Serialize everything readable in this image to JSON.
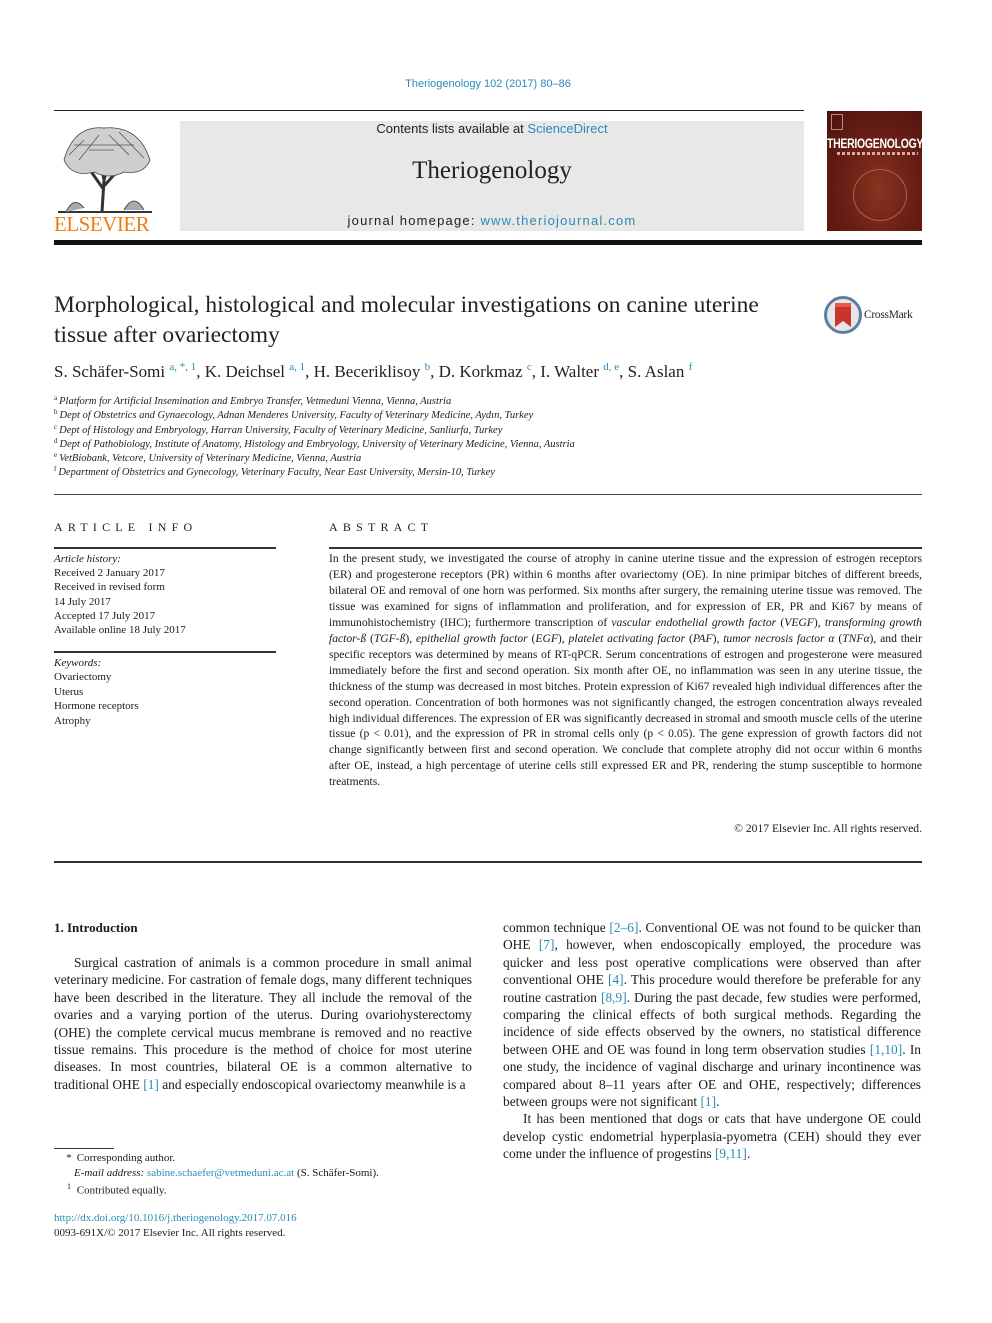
{
  "header": {
    "journal_ref": "Theriogenology 102 (2017) 80–86",
    "contents_prefix": "Contents lists available at ",
    "contents_link": "ScienceDirect",
    "journal_title": "Theriogenology",
    "homepage_prefix": "journal homepage: ",
    "homepage_link": "www.theriojournal.com",
    "publisher_logo_text": "ELSEVIER",
    "cover_title": "THERIOGENOLOGY",
    "brand_colors": {
      "link": "#2a8bb5",
      "elsevier_orange": "#f07d14",
      "cover": "#6b2016"
    }
  },
  "article": {
    "title": "Morphological, histological and molecular investigations on canine uterine tissue after ovariectomy",
    "crossmark_label": "CrossMark",
    "authors": [
      {
        "name": "S. Schäfer-Somi",
        "sup": "a, *, 1",
        "sep": ", "
      },
      {
        "name": "K. Deichsel",
        "sup": "a, 1",
        "sep": ", "
      },
      {
        "name": "H. Beceriklisoy",
        "sup": "b",
        "sep": ", "
      },
      {
        "name": "D. Korkmaz",
        "sup": "c",
        "sep": ", "
      },
      {
        "name": "I. Walter",
        "sup": "d, e",
        "sep": ", "
      },
      {
        "name": "S. Aslan",
        "sup": "f",
        "sep": ""
      }
    ],
    "affiliations": [
      {
        "key": "a",
        "text": "Platform for Artificial Insemination and Embryo Transfer, Vetmeduni Vienna, Vienna, Austria"
      },
      {
        "key": "b",
        "text": "Dept of Obstetrics and Gynaecology, Adnan Menderes University, Faculty of Veterinary Medicine, Aydın, Turkey"
      },
      {
        "key": "c",
        "text": "Dept of Histology and Embryology, Harran University, Faculty of Veterinary Medicine, Sanliurfa, Turkey"
      },
      {
        "key": "d",
        "text": "Dept of Pathobiology, Institute of Anatomy, Histology and Embryology, University of Veterinary Medicine, Vienna, Austria"
      },
      {
        "key": "e",
        "text": "VetBiobank, Vetcore, University of Veterinary Medicine, Vienna, Austria"
      },
      {
        "key": "f",
        "text": "Department of Obstetrics and Gynecology, Veterinary Faculty, Near East University, Mersin-10, Turkey"
      }
    ]
  },
  "article_info": {
    "heading": "ARTICLE INFO",
    "history_label": "Article history:",
    "history": [
      "Received 2 January 2017",
      "Received in revised form",
      "14 July 2017",
      "Accepted 17 July 2017",
      "Available online 18 July 2017"
    ],
    "keywords_label": "Keywords:",
    "keywords": [
      "Ovariectomy",
      "Uterus",
      "Hormone receptors",
      "Atrophy"
    ]
  },
  "abstract": {
    "heading": "ABSTRACT",
    "segments": [
      {
        "t": "In the present study, we investigated the course of atrophy in canine uterine tissue and the expression of estrogen receptors (ER) and progesterone receptors (PR) within 6 months after ovariectomy (OE). In nine primipar bitches of different breeds, bilateral OE and removal of one horn was performed. Six months after surgery, the remaining uterine tissue was removed. The tissue was examined for signs of inflam­mation and proliferation, and for expression of ER, PR and Ki67 by means of immunohistochemistry (IHC); furthermore transcription of "
      },
      {
        "t": "vascular endothelial growth factor",
        "i": true
      },
      {
        "t": " ("
      },
      {
        "t": "VEGF",
        "i": true
      },
      {
        "t": "), "
      },
      {
        "t": "transforming growth factor-ß",
        "i": true
      },
      {
        "t": " ("
      },
      {
        "t": "TGF-ß",
        "i": true
      },
      {
        "t": "), "
      },
      {
        "t": "epithelial growth factor",
        "i": true
      },
      {
        "t": " ("
      },
      {
        "t": "EGF",
        "i": true
      },
      {
        "t": "), "
      },
      {
        "t": "platelet activating factor",
        "i": true
      },
      {
        "t": " ("
      },
      {
        "t": "PAF",
        "i": true
      },
      {
        "t": "), "
      },
      {
        "t": "tumor necrosis factor α",
        "i": true
      },
      {
        "t": " ("
      },
      {
        "t": "TNFα",
        "i": true
      },
      {
        "t": "), and their specific receptors was determined by means of RT-qPCR. Serum concentrations of estrogen and progesterone were measured immediately before the first and second operation. Six month after OE, no inflammation was seen in any uterine tissue, the thickness of the stump was decreased in most bitches. Protein expression of Ki67 revealed high individual differences after the second operation. Concentration of both hormones was not significantly changed, the estrogen concentration always revealed high in­dividual differences. The expression of ER was significantly decreased in stromal and smooth muscle cells of the uterine tissue (p < 0.01), and the expression of PR in stromal cells only (p < 0.05). The gene expression of growth factors did not change significantly between first and second operation. We conclude that complete atrophy did not occur within 6 months after OE, instead, a high percentage of uterine cells still expressed ER and PR, rendering the stump susceptible to hormone treatments."
      }
    ],
    "copyright": "© 2017 Elsevier Inc. All rights reserved."
  },
  "body": {
    "section_heading": "1.  Introduction",
    "left_paragraph": [
      {
        "t": "Surgical castration of animals is a common procedure in small animal veterinary medicine. For castration of female dogs, many different techniques have been described in the literature. They all include the removal of the ovaries and a varying portion of the uterus. During ovariohysterectomy (OHE) the complete cervical mucus membrane is removed and no reactive tissue remains. This procedure is the method of choice for most uterine diseases. In most countries, bilateral OE is a common alternative to traditional OHE "
      },
      {
        "t": "[1]",
        "ref": true
      },
      {
        "t": " and especially endoscopical ovariectomy meanwhile is a"
      }
    ],
    "right_paragraph_1": [
      {
        "t": "common technique "
      },
      {
        "t": "[2–6]",
        "ref": true
      },
      {
        "t": ". Conventional OE was not found to be quicker than OHE "
      },
      {
        "t": "[7]",
        "ref": true
      },
      {
        "t": ", however, when endoscopically employed, the procedure was quicker and less post operative complications were observed than after conventional OHE "
      },
      {
        "t": "[4]",
        "ref": true
      },
      {
        "t": ". This procedure would therefore be preferable for any routine castration "
      },
      {
        "t": "[8,9]",
        "ref": true
      },
      {
        "t": ". During the past decade, few studies were performed, comparing the clinical effects of both surgical methods. Regarding the incidence of side effects observed by the owners, no statistical difference between OHE and OE was found in long term observation studies "
      },
      {
        "t": "[1,10]",
        "ref": true
      },
      {
        "t": ". In one study, the incidence of vaginal discharge and urinary inconti­nence was compared about 8–11 years after OE and OHE, respec­tively; differences between groups were not significant "
      },
      {
        "t": "[1]",
        "ref": true
      },
      {
        "t": "."
      }
    ],
    "right_paragraph_2": [
      {
        "t": "It has been mentioned that dogs or cats that have undergone OE could develop cystic endometrial hyperplasia-pyometra (CEH) should they ever come under the influence of progestins "
      },
      {
        "t": "[9,11]",
        "ref": true
      },
      {
        "t": "."
      }
    ]
  },
  "footnotes": {
    "corresponding_mark": "*",
    "corresponding_text": "Corresponding author.",
    "email_label": "E-mail address:",
    "email": "sabine.schaefer@vetmeduni.ac.at",
    "email_suffix": " (S. Schäfer-Somi).",
    "equal_mark": "1",
    "equal_text": "Contributed equally.",
    "doi": "http://dx.doi.org/10.1016/j.theriogenology.2017.07.016",
    "issn_line": "0093-691X/© 2017 Elsevier Inc. All rights reserved."
  }
}
